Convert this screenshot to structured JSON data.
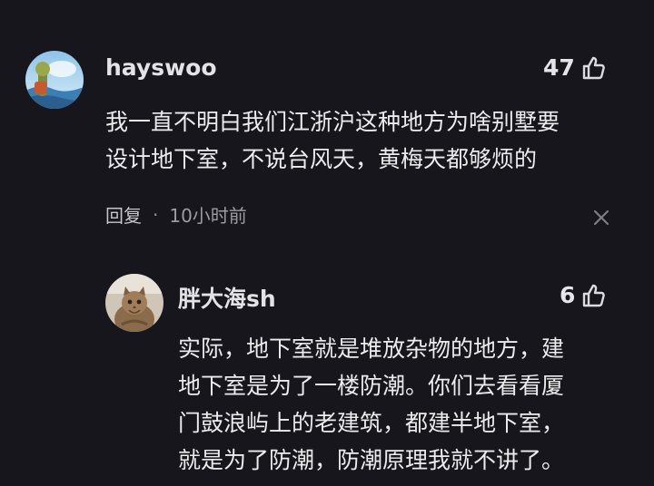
{
  "comment": {
    "username": "hayswoo",
    "likes": "47",
    "avatar_icon": "landscape-avatar",
    "text_lines": [
      "我一直不明白我们江浙沪这种地方为啥别墅要",
      "设计地下室，不说台风天，黄梅天都够烦的"
    ],
    "reply_label": "回复",
    "separator": "·",
    "time": "10小时前",
    "close_icon": "close-icon"
  },
  "reply": {
    "username": "胖大海sh",
    "likes": "6",
    "avatar_icon": "cat-avatar",
    "text_lines": [
      "实际，地下室就是堆放杂物的地方，建",
      "地下室是为了一楼防潮。你们去看看厦",
      "门鼓浪屿上的老建筑，都建半地下室，",
      "就是为了防潮，防潮原理我就不讲了。"
    ]
  },
  "colors": {
    "background": "#17161c",
    "text": "#ececef",
    "meta": "#9d9ca4"
  }
}
